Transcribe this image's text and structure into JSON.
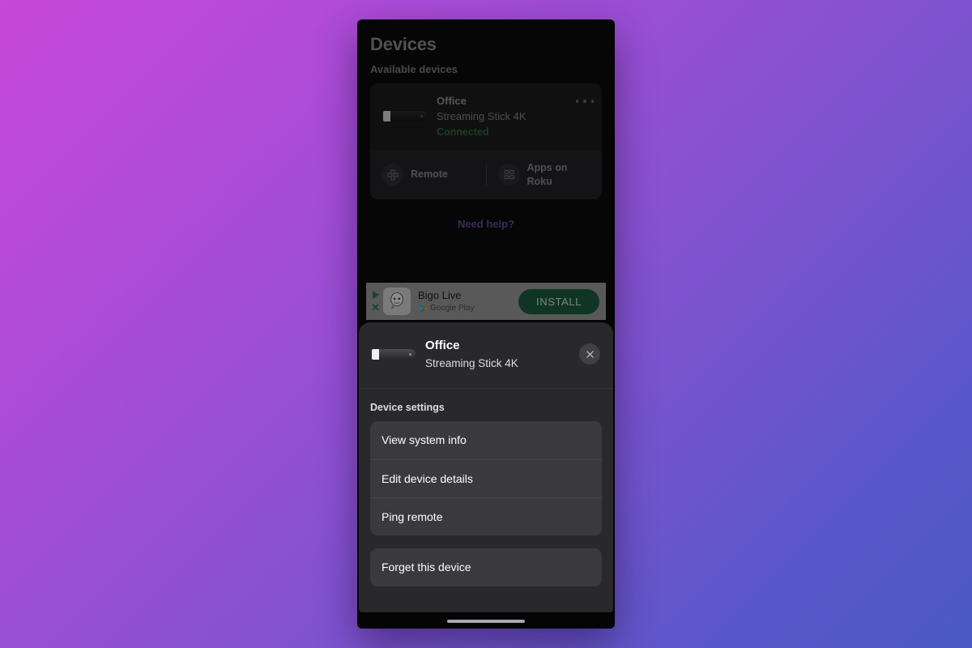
{
  "app": {
    "page_title": "Devices",
    "section_label": "Available devices"
  },
  "device_card": {
    "name": "Office",
    "model": "Streaming Stick 4K",
    "status": "Connected",
    "status_color": "#2f6b3d",
    "overflow_icon": "more-horizontal-icon",
    "thumb_icon": "streaming-stick-thumbnail",
    "actions": [
      {
        "label": "Remote",
        "icon": "dpad-icon"
      },
      {
        "label": "Apps on Roku",
        "icon": "grid-apps-icon"
      }
    ]
  },
  "help": {
    "label": "Need help?",
    "color": "#6a4b9c"
  },
  "ad": {
    "title": "Bigo Live",
    "store": "Google Play",
    "install_label": "INSTALL",
    "install_color": "#1d5c3f",
    "adchoices_icon": "adchoices-icon",
    "close_icon": "close-icon",
    "app_icon": "bigo-live-app-icon"
  },
  "sheet": {
    "title": "Office",
    "subtitle": "Streaming Stick 4K",
    "close_icon": "close-icon",
    "thumb_icon": "streaming-stick-thumbnail",
    "settings_label": "Device settings",
    "settings_items": [
      {
        "label": "View system info"
      },
      {
        "label": "Edit device details"
      },
      {
        "label": "Ping remote"
      }
    ],
    "forget_item": {
      "label": "Forget this device"
    }
  },
  "system": {
    "home_indicator": "home-indicator"
  }
}
